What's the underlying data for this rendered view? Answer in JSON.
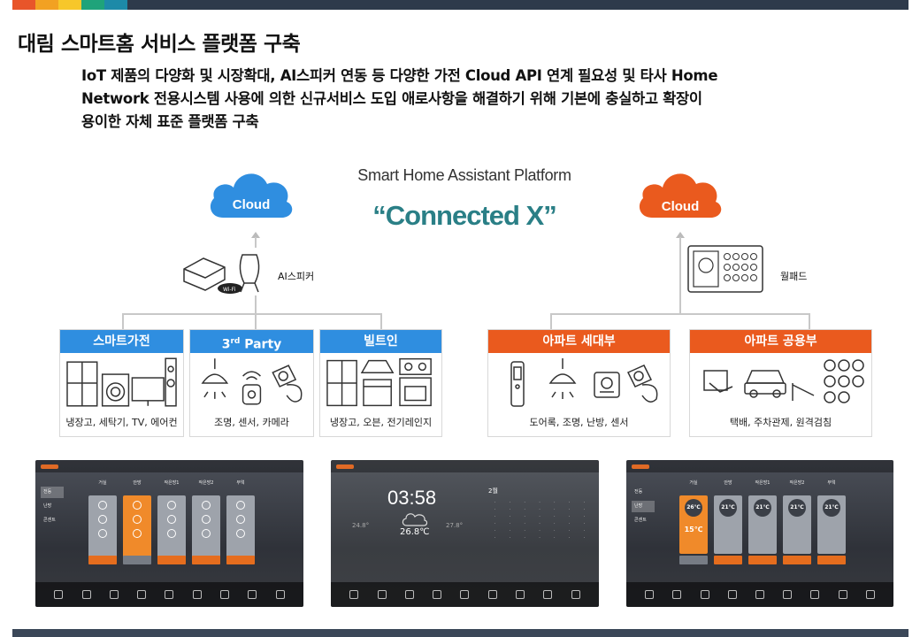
{
  "title": "대림 스마트홈 서비스 플랫폼 구축",
  "description": [
    "IoT 제품의 다양화 및 시장확대, AI스피커 연동 등 다양한 가전 Cloud API 연계 필요성 및 타사 Home",
    "Network 전용시스템 사용에 의한 신규서비스 도입 애로사항을 해결하기 위해 기본에 충실하고 확장이",
    "용이한 자체 표준 플랫폼 구축"
  ],
  "platform": {
    "subtitle": "Smart Home Assistant Platform",
    "name": "“Connected X”"
  },
  "left_cloud": {
    "label": "Cloud",
    "color": "#2f8ee0"
  },
  "right_cloud": {
    "label": "Cloud",
    "color": "#ea5a1e"
  },
  "ai_speaker_label": "AI스피커",
  "wallpad_label": "월패드",
  "categories": [
    {
      "title": "스마트가전",
      "caption": "냉장고, 세탁기, TV, 에어컨",
      "color": "#2f8ee0"
    },
    {
      "title_main": "3",
      "title_sup": "rd",
      "title_rest": " Party",
      "caption": "조명, 센서, 카메라",
      "color": "#2f8ee0"
    },
    {
      "title": "빌트인",
      "caption": "냉장고, 오븐, 전기레인지",
      "color": "#2f8ee0"
    },
    {
      "title": "아파트 세대부",
      "caption": "도어록, 조명, 난방, 센서",
      "color": "#ea5a1e"
    },
    {
      "title": "아파트 공용부",
      "caption": "택배, 주차관제, 원격검침",
      "color": "#ea5a1e"
    }
  ],
  "screens": {
    "lighting": {
      "rooms": [
        "거실",
        "안방",
        "작은방1",
        "작은방2",
        "부엌"
      ],
      "side": [
        "전등",
        "난방",
        "콘센트"
      ]
    },
    "clock": {
      "time": "03:58",
      "month": "2월",
      "temp_left": "24.8°",
      "temp_center": "26.8℃",
      "temp_right": "27.8°"
    },
    "heating": {
      "rooms": [
        "거실",
        "안방",
        "작은방1",
        "작은방2",
        "부엌"
      ],
      "current": [
        "26℃",
        "21℃",
        "21℃",
        "21℃",
        "21℃"
      ],
      "active_set": "15℃",
      "side": [
        "전등",
        "난방",
        "콘센트"
      ]
    }
  }
}
